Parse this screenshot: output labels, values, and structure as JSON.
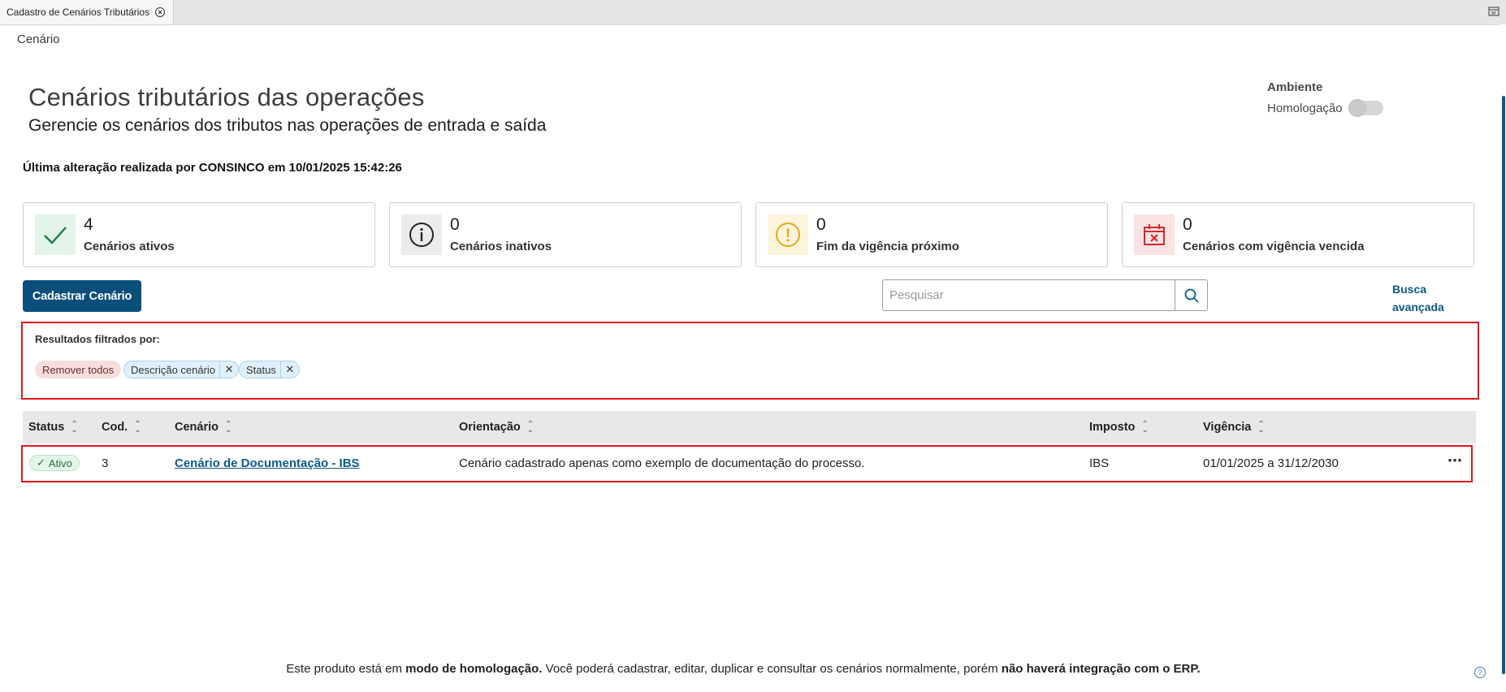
{
  "tab": {
    "title": "Cadastro de Cenários Tributários"
  },
  "breadcrumb": "Cenário",
  "header": {
    "title": "Cenários tributários das operações",
    "subtitle": "Gerencie os cenários dos tributos nas operações de entrada e saída"
  },
  "environment": {
    "label": "Ambiente",
    "mode_label": "Homologação",
    "toggle_on": false
  },
  "last_modified": "Última alteração realizada por CONSINCO em 10/01/2025 15:42:26",
  "cards": [
    {
      "count": "4",
      "label": "Cenários ativos",
      "icon": "check-icon",
      "color": "#1c7c46"
    },
    {
      "count": "0",
      "label": "Cenários inativos",
      "icon": "info-icon",
      "color": "#222222"
    },
    {
      "count": "0",
      "label": "Fim da vigência próximo",
      "icon": "warning-icon",
      "color": "#e6a817"
    },
    {
      "count": "0",
      "label": "Cenários com vigência vencida",
      "icon": "calendar-x-icon",
      "color": "#d42a2a"
    }
  ],
  "actions": {
    "register_label": "Cadastrar Cenário",
    "search_placeholder": "Pesquisar",
    "advanced_search_label": "Busca avançada"
  },
  "filters": {
    "title": "Resultados filtrados por:",
    "remove_all_label": "Remover todos",
    "chips": [
      "Descrição cenário",
      "Status"
    ]
  },
  "table": {
    "columns": [
      "Status",
      "Cod.",
      "Cenário",
      "Orientação",
      "Imposto",
      "Vigência"
    ],
    "rows": [
      {
        "status": "Ativo",
        "code": "3",
        "scenario": "Cenário de Documentação - IBS",
        "orientation": "Cenário cadastrado apenas como exemplo de documentação do processo.",
        "tax": "IBS",
        "validity": "01/01/2025 a 31/12/2030"
      }
    ]
  },
  "footer": {
    "part1": "Este produto está em ",
    "bold1": "modo de homologação.",
    "part2": " Você poderá cadastrar, editar, duplicar e consultar os cenários normalmente, porém ",
    "bold2": "não haverá integração com o ERP."
  },
  "colors": {
    "primary": "#0a4f7a",
    "link": "#0c5a8a",
    "highlight": "#e0161e"
  }
}
